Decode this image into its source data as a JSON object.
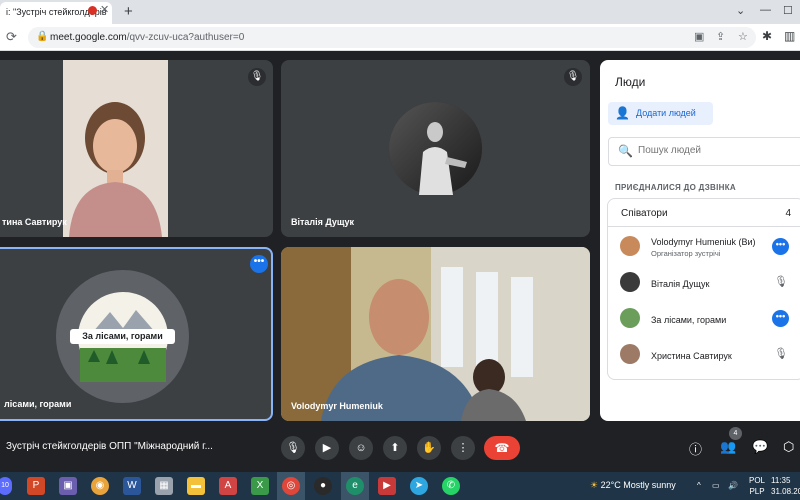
{
  "browser": {
    "tab_title": "і: \"Зустріч стейкголдерів",
    "new_tab_label": "+",
    "url_host": "meet.google.com",
    "url_path": "/qvv-zcuv-uca?authuser=0"
  },
  "tiles": [
    {
      "name": "тина Савтирук",
      "muted": true
    },
    {
      "name": "Віталія Дущук",
      "muted": true
    },
    {
      "name": "лісами, горами",
      "logo_text": "За лісами, горами"
    },
    {
      "name": "Volodymyr Humeniuk"
    }
  ],
  "people_panel": {
    "title": "Люди",
    "add_people_label": "Додати людей",
    "search_placeholder": "Пошук людей",
    "joined_header": "ПРИЄДНАЛИСЯ ДО ДЗВІНКА",
    "group_label": "Співатори",
    "group_count": "4",
    "participants": [
      {
        "name": "Volodymyr Humeniuk (Ви)",
        "role": "Організатор зустрічі",
        "action": "more"
      },
      {
        "name": "Віталія Дущук",
        "action": "muted"
      },
      {
        "name": "За лісами, горами",
        "action": "more"
      },
      {
        "name": "Христина Савтирук",
        "action": "muted"
      }
    ]
  },
  "controls": {
    "meeting_title": "Зустріч стейкголдерів ОПП \"Міжнародний г...",
    "people_badge": "4"
  },
  "taskbar": {
    "notif_badge": "10",
    "temperature": "22°C",
    "weather": "Mostly sunny",
    "lang_top": "POL",
    "lang_bottom": "PLP",
    "time": "11:35",
    "date": "31.08.20"
  },
  "colors": {
    "accent": "#1a73e8",
    "end_call": "#ea4335",
    "tile_bg": "#3c4043",
    "active_border": "#8ab4f8"
  }
}
